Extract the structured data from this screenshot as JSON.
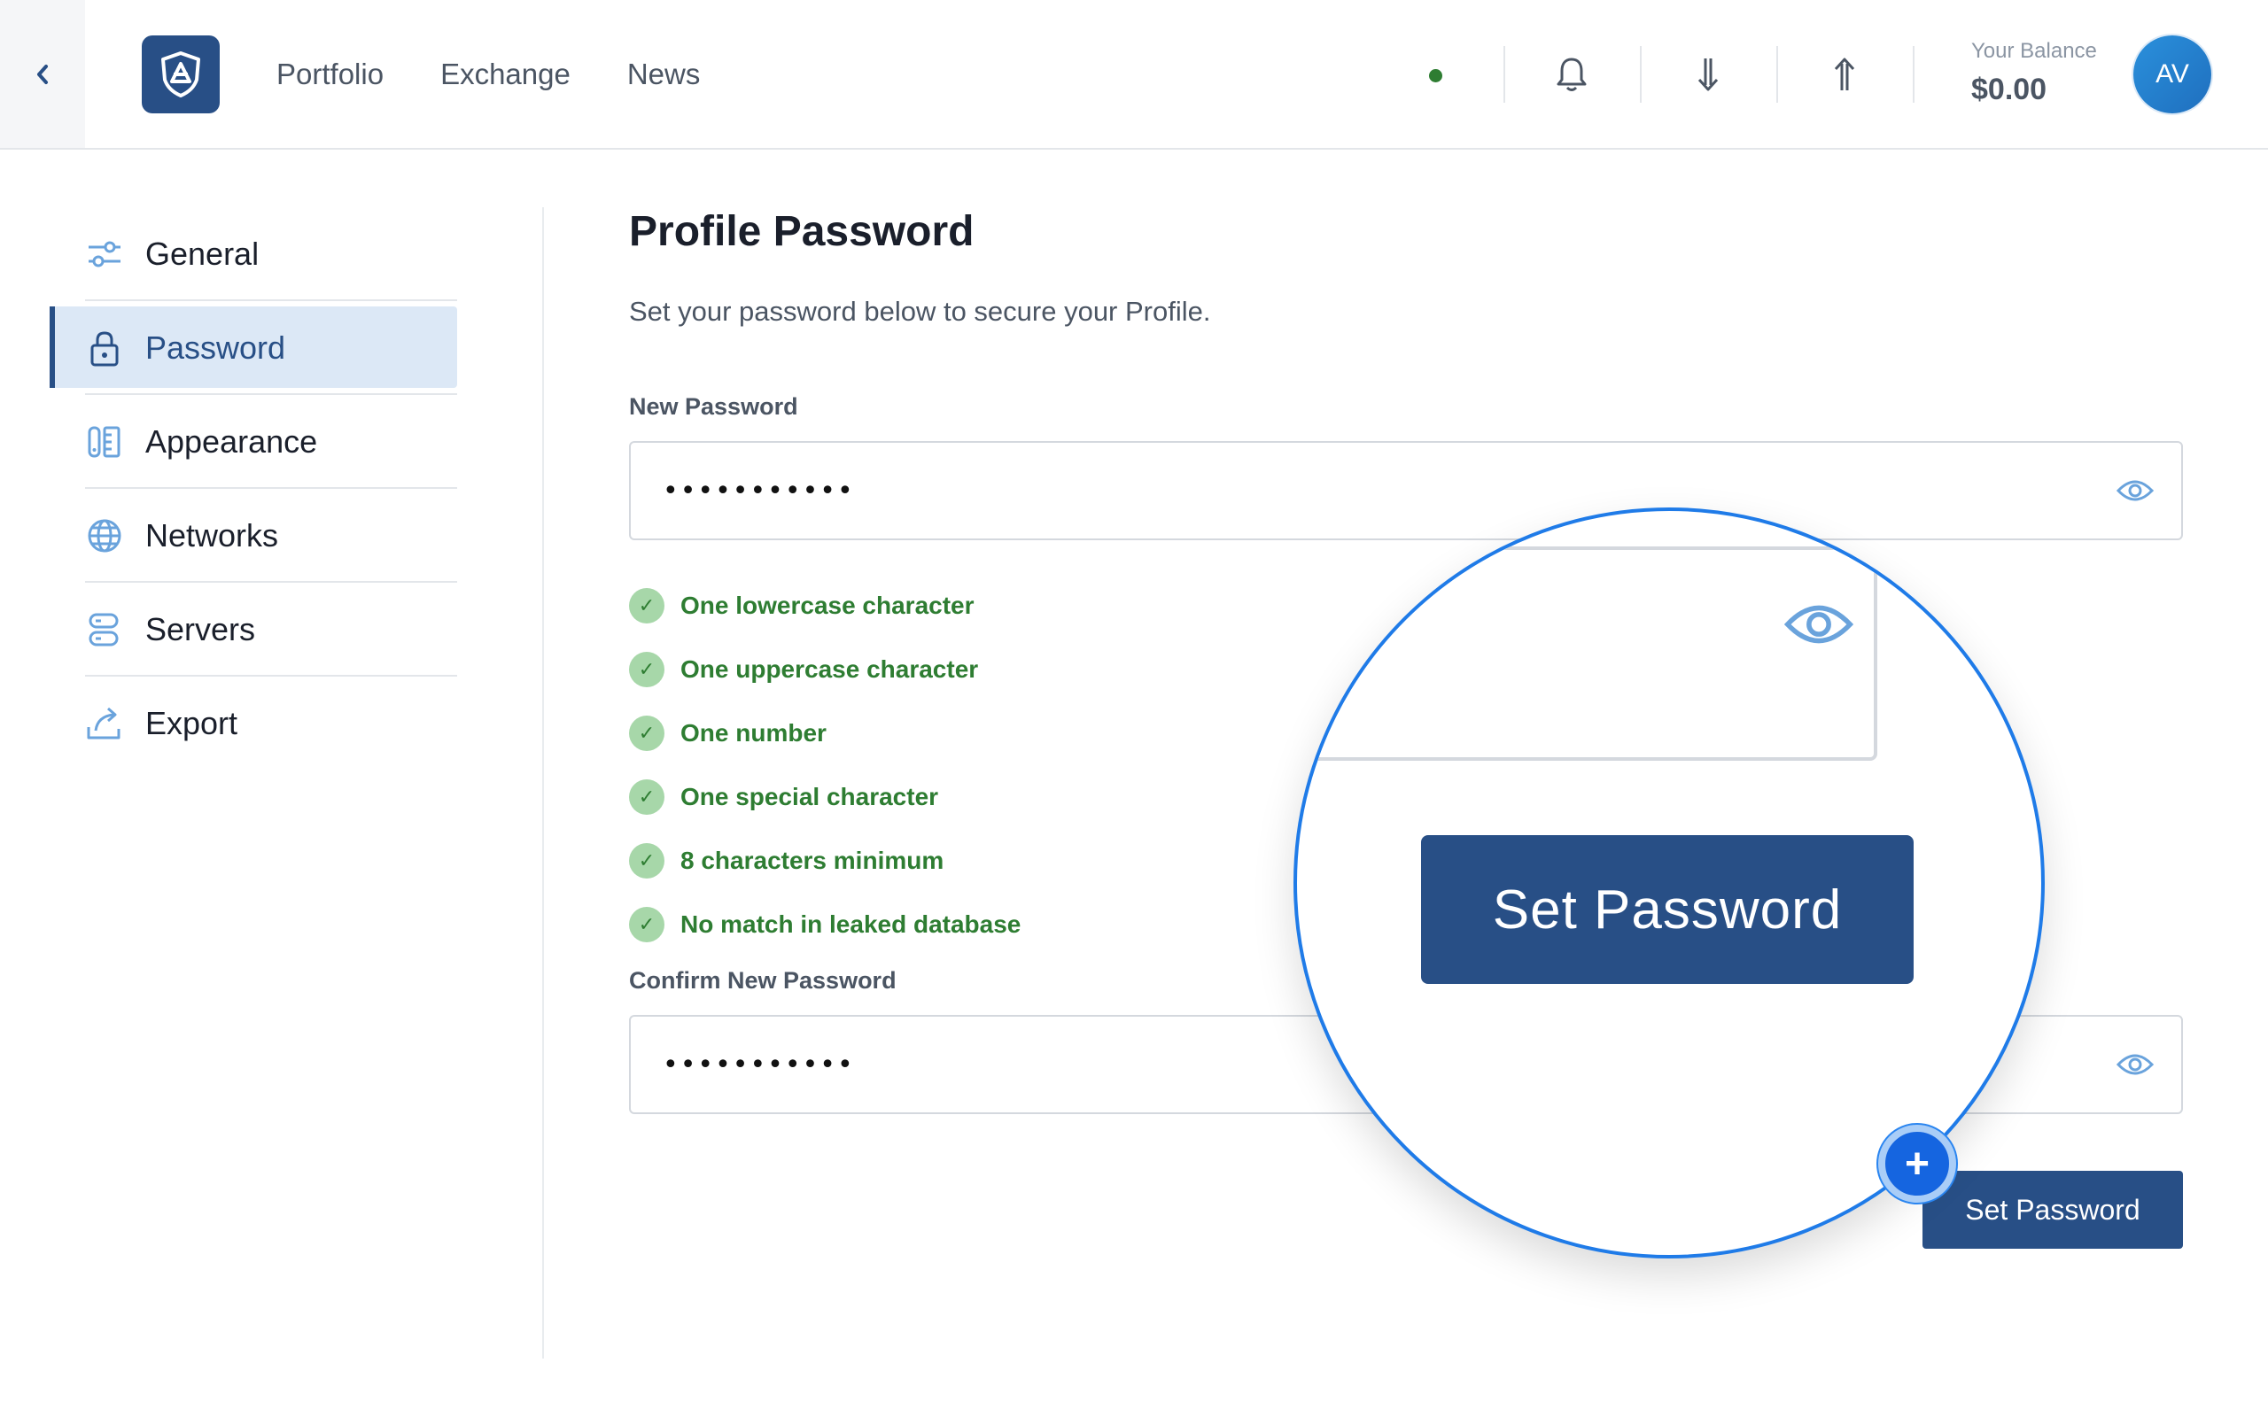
{
  "header": {
    "nav": [
      "Portfolio",
      "Exchange",
      "News"
    ],
    "balance_label": "Your Balance",
    "balance_value": "$0.00",
    "avatar_initials": "AV",
    "status_color": "#2e7d32"
  },
  "sidebar": {
    "items": [
      {
        "label": "General",
        "icon": "sliders-icon"
      },
      {
        "label": "Password",
        "icon": "lock-icon",
        "active": true
      },
      {
        "label": "Appearance",
        "icon": "palette-icon"
      },
      {
        "label": "Networks",
        "icon": "globe-icon"
      },
      {
        "label": "Servers",
        "icon": "server-icon"
      },
      {
        "label": "Export",
        "icon": "export-icon"
      }
    ]
  },
  "main": {
    "title": "Profile Password",
    "description": "Set your password below to secure your Profile.",
    "new_password": {
      "label": "New Password",
      "value": "•••••••••••"
    },
    "requirements": [
      "One lowercase character",
      "One uppercase character",
      "One number",
      "One special character",
      "8 characters minimum",
      "No match in leaked database"
    ],
    "confirm_password": {
      "label": "Confirm New Password",
      "value": "•••••••••••"
    },
    "submit_label": "Set Password"
  },
  "magnifier": {
    "button_label": "Set Password",
    "plus_symbol": "+"
  },
  "colors": {
    "primary": "#284f86",
    "success": "#2e7d32",
    "success_bg": "#a7d7a9",
    "accent_blue": "#1f7be8",
    "active_bg": "#dce8f6"
  }
}
